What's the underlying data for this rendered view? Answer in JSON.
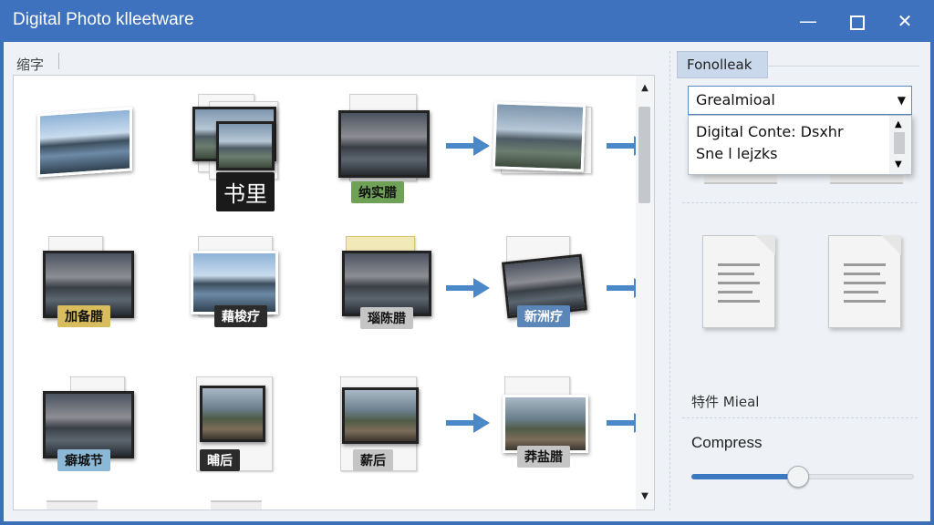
{
  "window": {
    "title": "Digital Photo klleetware",
    "minimize_icon": "minimize-icon",
    "maximize_icon": "maximize-icon",
    "close_icon": "close-icon",
    "accent_color": "#3e72bf"
  },
  "toolbar": {
    "path_label": "缩字"
  },
  "grid": {
    "rows": [
      {
        "items": [
          {
            "label": ""
          },
          {
            "label": "书里"
          },
          {
            "label": "纳实腊"
          },
          {
            "label": ""
          }
        ]
      },
      {
        "items": [
          {
            "label": "加备腊"
          },
          {
            "label": "藉梭疗"
          },
          {
            "label": "瑙陈腊"
          },
          {
            "label": "新洲疗"
          }
        ]
      },
      {
        "items": [
          {
            "label": "癖城节"
          },
          {
            "label": "晡后"
          },
          {
            "label": "薪后"
          },
          {
            "label": "莽盐腊"
          }
        ]
      }
    ],
    "scroll_up_icon": "▲",
    "scroll_down_icon": "▼",
    "arrow_color": "#4a88c8"
  },
  "panel": {
    "tab_label": "Fonolleak",
    "select_value": "Grealmioal",
    "dropdown_options": [
      "Digital Conte: Dsxhr",
      "Sne l lejzks"
    ],
    "section_label": "特件 Mieal",
    "compress_label": "Compress",
    "compress_value": 0.48,
    "caret_down": "▼",
    "caret_up": "▲"
  }
}
